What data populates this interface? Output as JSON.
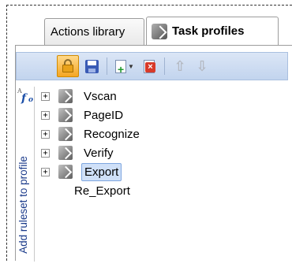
{
  "tabs": [
    {
      "label": "Actions library",
      "active": false
    },
    {
      "label": "Task profiles",
      "active": true,
      "icon": "task-profile-icon"
    }
  ],
  "toolbar": {
    "buttons": [
      {
        "name": "lock",
        "icon": "lock-icon",
        "active": true
      },
      {
        "name": "save",
        "icon": "floppy-disk-icon"
      },
      {
        "name": "add",
        "icon": "add-document-icon",
        "has_dropdown": true
      },
      {
        "name": "delete",
        "icon": "delete-document-icon"
      },
      {
        "name": "move-up",
        "icon": "arrow-up-icon",
        "enabled": false
      },
      {
        "name": "move-down",
        "icon": "arrow-down-icon",
        "enabled": false
      }
    ]
  },
  "side_panel": {
    "label": "Add ruleset to profile",
    "icon": "function-icon"
  },
  "tree": {
    "nodes": [
      {
        "label": "Vscan",
        "expandable": true,
        "selected": false
      },
      {
        "label": "PageID",
        "expandable": true,
        "selected": false
      },
      {
        "label": "Recognize",
        "expandable": true,
        "selected": false
      },
      {
        "label": "Verify",
        "expandable": true,
        "selected": false
      },
      {
        "label": "Export",
        "expandable": true,
        "selected": true
      }
    ],
    "leaf": {
      "label": "Re_Export"
    }
  },
  "colors": {
    "toolbar_bg": "#c9d9f0",
    "selection_bg": "#cfe0f8",
    "side_label": "#1a3a8a",
    "active_button": "#f5a623"
  }
}
